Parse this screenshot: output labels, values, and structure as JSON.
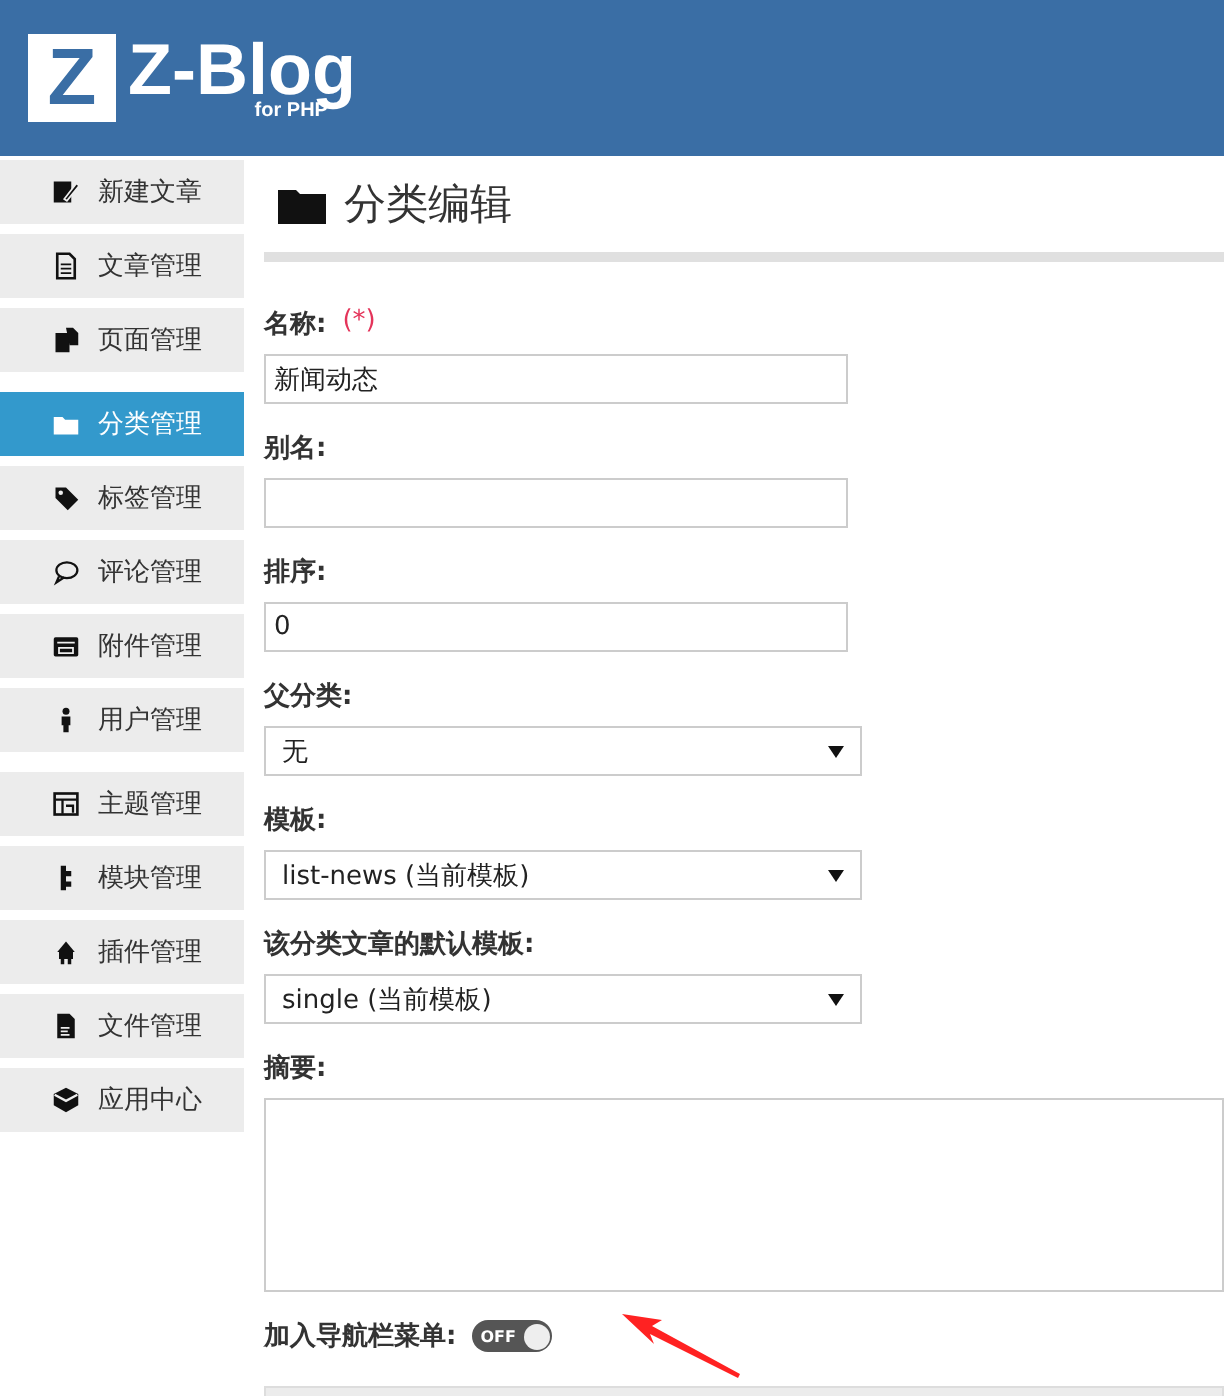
{
  "header": {
    "logo_mark": "Z",
    "logo_title": "Z-Blog",
    "logo_subtitle": "for PHP"
  },
  "sidebar": {
    "groups": [
      {
        "items": [
          {
            "label": "新建文章",
            "selected": false
          },
          {
            "label": "文章管理",
            "selected": false
          },
          {
            "label": "页面管理",
            "selected": false
          }
        ]
      },
      {
        "items": [
          {
            "label": "分类管理",
            "selected": true
          },
          {
            "label": "标签管理",
            "selected": false
          },
          {
            "label": "评论管理",
            "selected": false
          },
          {
            "label": "附件管理",
            "selected": false
          },
          {
            "label": "用户管理",
            "selected": false
          }
        ]
      },
      {
        "items": [
          {
            "label": "主题管理",
            "selected": false
          },
          {
            "label": "模块管理",
            "selected": false
          },
          {
            "label": "插件管理",
            "selected": false
          },
          {
            "label": "文件管理",
            "selected": false
          },
          {
            "label": "应用中心",
            "selected": false
          }
        ]
      }
    ]
  },
  "page_title": "分类编辑",
  "form": {
    "fields": [
      {
        "kind": "input",
        "label": "名称:",
        "required_mark": "(*)",
        "value": "新闻动态"
      },
      {
        "kind": "input",
        "label": "别名:"
      },
      {
        "kind": "input",
        "label": "排序:",
        "value": "0"
      },
      {
        "kind": "select",
        "label": "父分类:",
        "value": "无"
      },
      {
        "kind": "select",
        "label": "模板:",
        "value": "list-news (当前模板)"
      },
      {
        "kind": "select",
        "label": "该分类文章的默认模板:",
        "value": "single (当前模板)"
      },
      {
        "kind": "textarea",
        "label": "摘要:"
      }
    ],
    "toggle": {
      "label": "加入导航栏菜单:",
      "text": "OFF",
      "on": false
    }
  }
}
